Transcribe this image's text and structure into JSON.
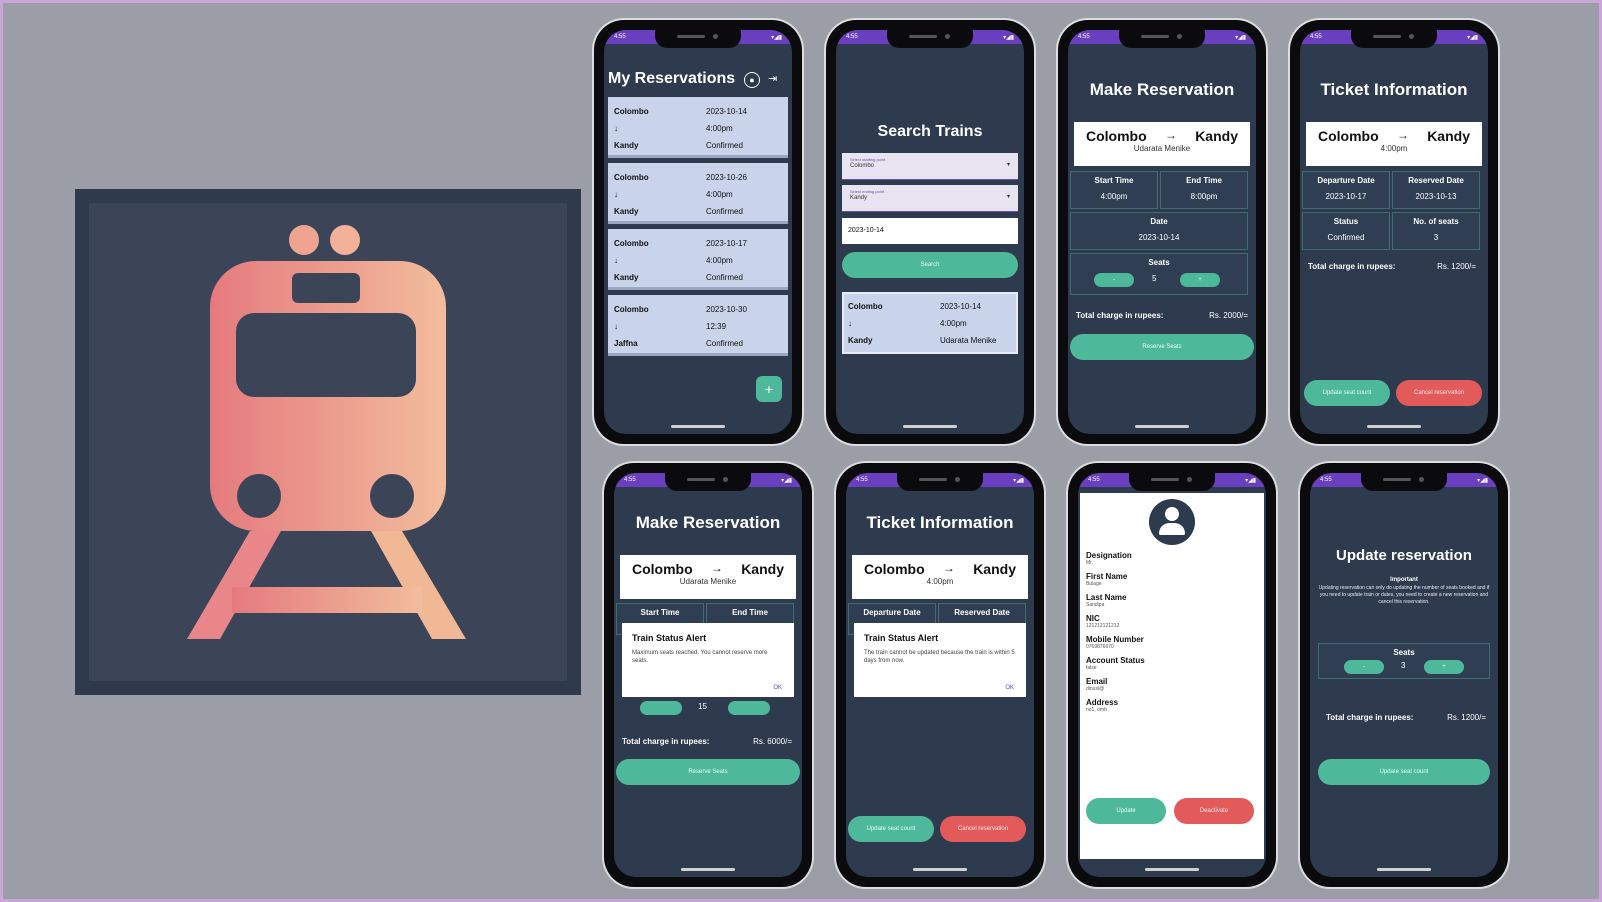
{
  "phone1": {
    "title": "My Reservations",
    "reservations": [
      {
        "from": "Colombo",
        "to": "Kandy",
        "date": "2023-10-14",
        "time": "4:00pm",
        "status": "Confirmed"
      },
      {
        "from": "Colombo",
        "to": "Kandy",
        "date": "2023-10-26",
        "time": "4:00pm",
        "status": "Confirmed"
      },
      {
        "from": "Colombo",
        "to": "Kandy",
        "date": "2023-10-17",
        "time": "4:00pm",
        "status": "Confirmed"
      },
      {
        "from": "Colombo",
        "to": "Jaffna",
        "date": "2023-10-30",
        "time": "12:39",
        "status": "Confirmed"
      }
    ],
    "fab": "+"
  },
  "phone2": {
    "title": "Search Trains",
    "start_hint": "Select starting point",
    "start_value": "Colombo",
    "end_hint": "Select ending point",
    "end_value": "Kandy",
    "date": "2023-10-14",
    "search_label": "Search",
    "result": {
      "from": "Colombo",
      "to": "Kandy",
      "date": "2023-10-14",
      "time": "4:00pm",
      "train": "Udarata Menike"
    }
  },
  "phone3": {
    "title": "Make Reservation",
    "from": "Colombo",
    "to": "Kandy",
    "train": "Udarata Menike",
    "start_time_label": "Start Time",
    "start_time": "4:00pm",
    "end_time_label": "End Time",
    "end_time": "8:00pm",
    "date_label": "Date",
    "date": "2023-10-14",
    "seats_label": "Seats",
    "seats": "5",
    "minus": "-",
    "plus": "+",
    "charge_label": "Total charge in rupees:",
    "charge": "Rs. 2000/=",
    "reserve_label": "Reserve Seats"
  },
  "phone4": {
    "title": "Ticket Information",
    "from": "Colombo",
    "to": "Kandy",
    "time": "4:00pm",
    "departure_label": "Departure Date",
    "departure": "2023-10-17",
    "reserved_label": "Reserved Date",
    "reserved": "2023-10-13",
    "status_label": "Status",
    "status": "Confirmed",
    "seats_label": "No. of seats",
    "seats": "3",
    "charge_label": "Total charge in rupees:",
    "charge": "Rs. 1200/=",
    "update_label": "Update seat count",
    "cancel_label": "Cancel reservation"
  },
  "phone5": {
    "title": "Make Reservation",
    "from": "Colombo",
    "to": "Kandy",
    "train": "Udarata Menike",
    "start_time_label": "Start Time",
    "end_time_label": "End Time",
    "dialog_title": "Train Status Alert",
    "dialog_msg": "Maximum seats reached. You cannot reserve more seats.",
    "dialog_ok": "OK",
    "seats": "15",
    "charge_label": "Total charge in rupees:",
    "charge": "Rs. 6000/=",
    "reserve_label": "Reserve Seats"
  },
  "phone6": {
    "title": "Ticket Information",
    "from": "Colombo",
    "to": "Kandy",
    "time": "4:00pm",
    "departure_label": "Departure Date",
    "reserved_label": "Reserved Date",
    "dialog_title": "Train Status Alert",
    "dialog_msg": "The train cannot be updated because the train is within 5 days from now.",
    "dialog_ok": "OK",
    "update_label": "Update seat count",
    "cancel_label": "Cancel reservation"
  },
  "phone7": {
    "fields": [
      {
        "label": "Designation",
        "value": "Mr."
      },
      {
        "label": "First Name",
        "value": "Bulage"
      },
      {
        "label": "Last Name",
        "value": "Sandipa"
      },
      {
        "label": "NIC",
        "value": "121212121212"
      },
      {
        "label": "Mobile Number",
        "value": "0769876670"
      },
      {
        "label": "Account Status",
        "value": "false"
      },
      {
        "label": "Email",
        "value": "dinusl@"
      },
      {
        "label": "Address",
        "value": "no1, omb"
      }
    ],
    "update_label": "Update",
    "deactivate_label": "Deactivate"
  },
  "phone8": {
    "title": "Update reservation",
    "important_label": "Important",
    "important_msg": "Updating reservation can only do updating the number of seats booked and if you need to update train or dates, you need to create a new reservation and cancel this reservation.",
    "seats_label": "Seats",
    "seats": "3",
    "minus": "-",
    "plus": "+",
    "charge_label": "Total charge in rupees:",
    "charge": "Rs. 1200/=",
    "update_label": "Update seat count"
  },
  "status_time": "4:55"
}
